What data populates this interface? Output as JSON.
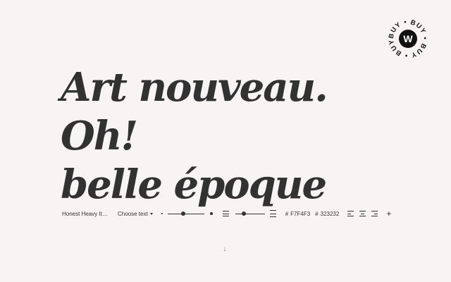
{
  "badge": {
    "ring_text": "BUY • BUY • BUY • BUY •",
    "letter": "W"
  },
  "headline": {
    "line1": "Art nouveau.",
    "line2": "Oh!",
    "line3": "belle époque"
  },
  "toolbar": {
    "font_name": "Honest Heavy Italic",
    "choose_text_label": "Choose text",
    "size_slider_value": 0.42,
    "line_height_slider_value": 0.3,
    "background_hash": "#",
    "background_color": "F7F4F3",
    "text_hash": "#",
    "text_color": "323232"
  },
  "colors": {
    "background": "#F7F4F3",
    "text": "#323232"
  },
  "icons": {
    "font_size_small": "dot-small-icon",
    "font_size_large": "dot-large-icon",
    "line_height_tight": "line-height-tight-icon",
    "line_height_loose": "line-height-loose-icon",
    "align_left": "align-left-icon",
    "align_center": "align-center-icon",
    "align_right": "align-right-icon",
    "add": "plus-icon",
    "scroll_down": "arrow-down-icon"
  },
  "plus_label": "+",
  "scroll_arrow": "↓"
}
